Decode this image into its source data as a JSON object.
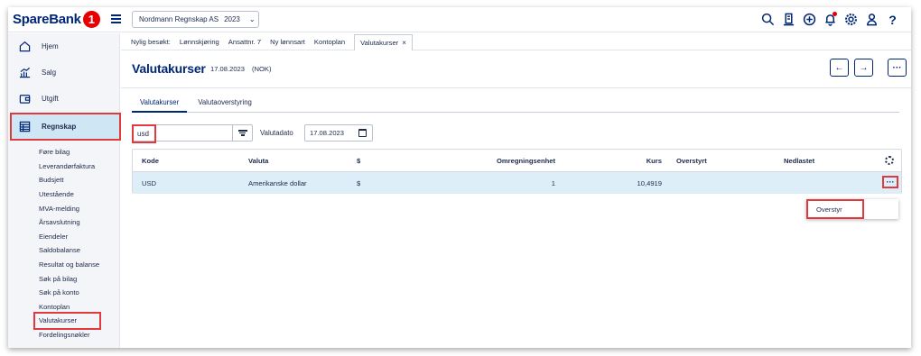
{
  "brand": {
    "name": "SpareBank",
    "badge": "1"
  },
  "company": {
    "name": "Nordmann Regnskap AS",
    "year": "2023"
  },
  "topbar_icons": [
    "search-icon",
    "building-icon",
    "add-circle-icon",
    "bell-icon",
    "gear-icon",
    "user-icon",
    "help-icon"
  ],
  "help_glyph": "?",
  "sidebar": {
    "main": [
      {
        "label": "Hjem",
        "icon": "home-icon"
      },
      {
        "label": "Salg",
        "icon": "chart-icon"
      },
      {
        "label": "Utgift",
        "icon": "wallet-icon"
      },
      {
        "label": "Regnskap",
        "icon": "ledger-icon"
      }
    ],
    "sub": [
      "Føre bilag",
      "Leverandørfaktura",
      "Budsjett",
      "Utestående",
      "MVA-melding",
      "Årsavslutning",
      "Eiendeler",
      "Saldobalanse",
      "Resultat og balanse",
      "Søk på bilag",
      "Søk på konto",
      "Kontoplan",
      "Valutakurser",
      "Fordelingsnøkler"
    ]
  },
  "recent": {
    "label": "Nylig besøkt:",
    "tabs": [
      "Lønnskjøring",
      "Ansattnr. 7",
      "Ny lønnsart",
      "Kontoplan",
      "Valutakurser"
    ],
    "close": "×"
  },
  "page": {
    "title": "Valutakurser",
    "date": "17.08.2023",
    "currency": "(NOK)",
    "prev": "←",
    "next": "→",
    "more": "···"
  },
  "subtabs": [
    "Valutakurser",
    "Valutaoverstyring"
  ],
  "filter": {
    "search_value": "usd",
    "date_label": "Valutadato",
    "date_value": "17.08.2023"
  },
  "table": {
    "headers": [
      "Kode",
      "Valuta",
      "$",
      "Omregningsenhet",
      "Kurs",
      "Overstyrt",
      "Nedlastet"
    ],
    "rows": [
      [
        "USD",
        "Amerikanske dollar",
        "$",
        "1",
        "10,4919",
        "",
        ""
      ]
    ],
    "row_more": "···"
  },
  "context_menu": {
    "items": [
      "Overstyr"
    ]
  },
  "colors": {
    "brand": "#002776",
    "highlight": "#e0393e",
    "selected_row": "#deeef8",
    "active_nav": "#cfe6f5"
  }
}
